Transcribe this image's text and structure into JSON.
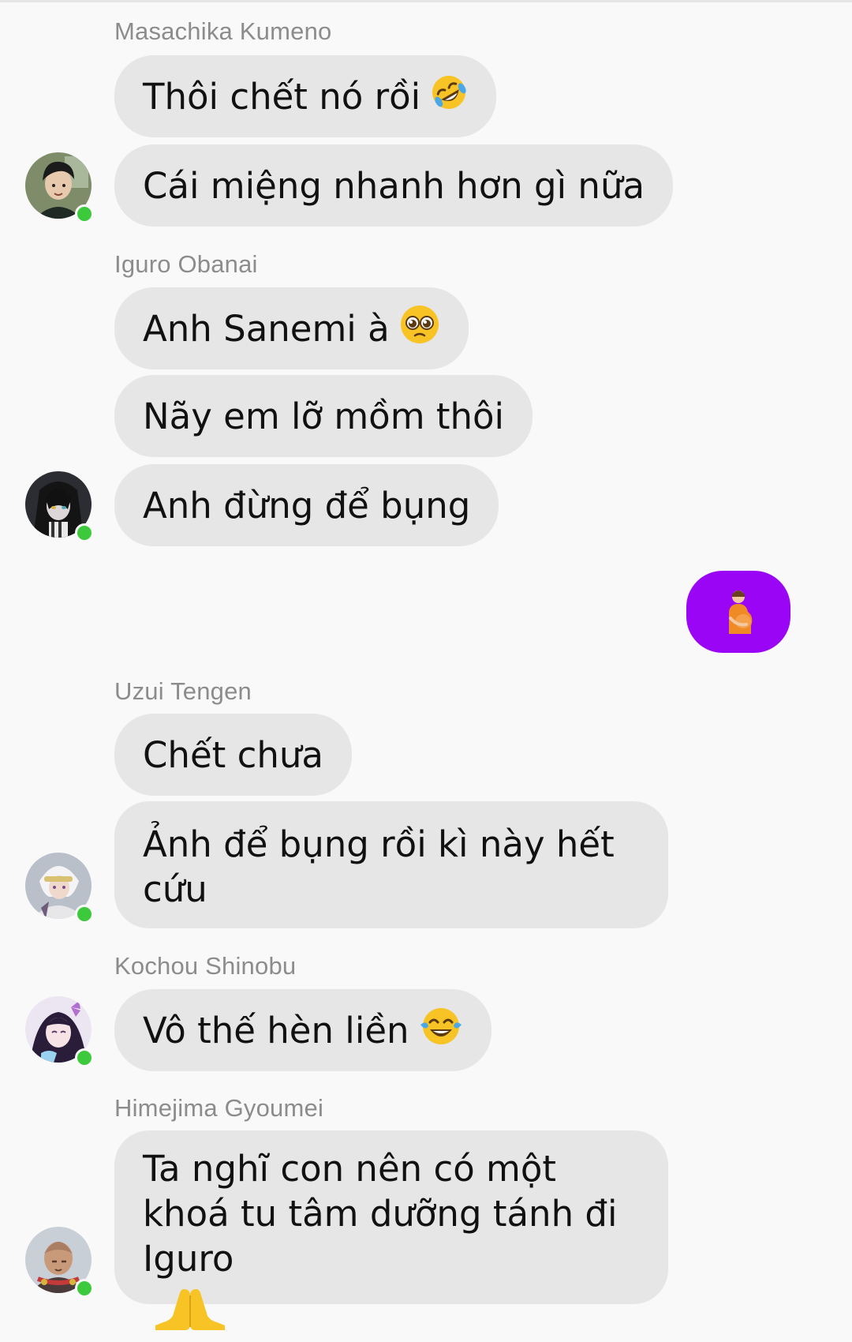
{
  "colors": {
    "background": "#f9f9f9",
    "incoming_bubble": "#e6e6e6",
    "outgoing_bubble": "#9b05f5",
    "sender_name": "#8c8c8c",
    "online": "#3cc93c"
  },
  "groups": [
    {
      "sender": "Masachika Kumeno",
      "avatar_icon": "avatar-dark-hair-man",
      "online": true,
      "messages": [
        {
          "text": "Thôi chết nó rồi",
          "emoji_icon": "rolling-on-floor-laughing-emoji"
        },
        {
          "text": "Cái miệng nhanh hơn gì nữa"
        }
      ]
    },
    {
      "sender": "Iguro Obanai",
      "avatar_icon": "avatar-dark-long-hair",
      "online": true,
      "messages": [
        {
          "text": "Anh Sanemi à",
          "emoji_icon": "pleading-face-emoji"
        },
        {
          "text": "Nãy em lỡ mồm thôi"
        },
        {
          "text": "Anh đừng để bụng"
        }
      ]
    },
    {
      "outgoing": true,
      "messages": [
        {
          "emoji_icon": "pregnant-man-emoji"
        }
      ]
    },
    {
      "sender": "Uzui Tengen",
      "avatar_icon": "avatar-white-hair",
      "online": true,
      "messages": [
        {
          "text": "Chết chưa"
        },
        {
          "text": "Ảnh để bụng rồi kì này hết cứu"
        }
      ]
    },
    {
      "sender": "Kochou Shinobu",
      "avatar_icon": "avatar-purple-butterfly",
      "online": true,
      "messages": [
        {
          "text": "Vô thế hèn liền",
          "emoji_icon": "face-with-tears-of-joy-emoji"
        }
      ]
    },
    {
      "sender": "Himejima Gyoumei",
      "avatar_icon": "avatar-bald-monk",
      "online": true,
      "messages": [
        {
          "text": "Ta nghĩ con nên có một khoá tu tâm dưỡng tánh đi Iguro",
          "emoji_icon": "folded-hands-emoji"
        }
      ]
    }
  ]
}
